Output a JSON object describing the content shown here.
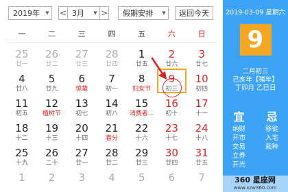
{
  "toolbar": {
    "year": "2019年",
    "prev": "<",
    "month": "3月",
    "next": ">",
    "holiday": "假期安排",
    "today": "返回今天"
  },
  "weekdays": [
    {
      "label": "一",
      "weekend": false
    },
    {
      "label": "二",
      "weekend": false
    },
    {
      "label": "三",
      "weekend": false
    },
    {
      "label": "四",
      "weekend": false
    },
    {
      "label": "五",
      "weekend": false
    },
    {
      "label": "六",
      "weekend": true
    },
    {
      "label": "日",
      "weekend": true
    }
  ],
  "weeks": [
    [
      {
        "d": "25",
        "s": "廿一",
        "other": true
      },
      {
        "d": "26",
        "s": "廿二",
        "other": true
      },
      {
        "d": "27",
        "s": "廿三",
        "other": true
      },
      {
        "d": "28",
        "s": "廿四",
        "other": true
      },
      {
        "d": "1",
        "s": "廿五"
      },
      {
        "d": "2",
        "s": "廿六",
        "weekend": true
      },
      {
        "d": "3",
        "s": "廿七",
        "weekend": true
      }
    ],
    [
      {
        "d": "4",
        "s": "廿八"
      },
      {
        "d": "5",
        "s": "廿九"
      },
      {
        "d": "6",
        "s": "惊蛰",
        "festival": true
      },
      {
        "d": "7",
        "s": "初一"
      },
      {
        "d": "8",
        "s": "妇女节",
        "festival": true
      },
      {
        "d": "9",
        "s": "初三",
        "weekend": true,
        "selected": true
      },
      {
        "d": "10",
        "s": "初四",
        "weekend": true
      }
    ],
    [
      {
        "d": "11",
        "s": "初五"
      },
      {
        "d": "12",
        "s": "植树节",
        "festival": true
      },
      {
        "d": "13",
        "s": "初七"
      },
      {
        "d": "14",
        "s": "初八"
      },
      {
        "d": "15",
        "s": "消费者...",
        "festival": true
      },
      {
        "d": "16",
        "s": "初十",
        "weekend": true
      },
      {
        "d": "17",
        "s": "十一",
        "weekend": true
      }
    ],
    [
      {
        "d": "18",
        "s": "十二"
      },
      {
        "d": "19",
        "s": "十三"
      },
      {
        "d": "20",
        "s": "十四"
      },
      {
        "d": "21",
        "s": "春分",
        "festival": true
      },
      {
        "d": "22",
        "s": "十六"
      },
      {
        "d": "23",
        "s": "十七",
        "weekend": true
      },
      {
        "d": "24",
        "s": "十八",
        "weekend": true
      }
    ],
    [
      {
        "d": "25",
        "s": "十九"
      },
      {
        "d": "26",
        "s": "二十"
      },
      {
        "d": "27",
        "s": "廿一"
      },
      {
        "d": "28",
        "s": "廿二"
      },
      {
        "d": "29",
        "s": "廿三"
      },
      {
        "d": "30",
        "s": "廿四",
        "weekend": true
      },
      {
        "d": "31",
        "s": "廿五",
        "weekend": true
      }
    ],
    [
      {
        "d": "1",
        "s": "",
        "other": true
      },
      {
        "d": "2",
        "s": "",
        "other": true
      },
      {
        "d": "3",
        "s": "",
        "other": true
      },
      {
        "d": "4",
        "s": "",
        "other": true
      },
      {
        "d": "5",
        "s": "",
        "other": true
      },
      {
        "d": "6",
        "s": "",
        "other": true
      },
      {
        "d": "7",
        "s": "",
        "other": true
      }
    ]
  ],
  "side": {
    "date_line": "2019-03-09 星期六",
    "big_day": "9",
    "lunar": "二月初三",
    "ganzhi_year": "己亥年【猪年】",
    "ganzhi_month_day": "丁卯月 乙巳日",
    "yi_label": "宜",
    "yi": [
      "纳财",
      "开市",
      "交易",
      "立券",
      "开光"
    ],
    "ji_label": "忌",
    "ji": [
      "移徙",
      "入宅",
      "栽种"
    ]
  },
  "watermark": {
    "brand": "360 星座网",
    "url": "www.xzw360.com"
  },
  "colors": {
    "accent_blue": "#3da3f4",
    "accent_orange": "#f5a623",
    "red": "#e02020"
  }
}
